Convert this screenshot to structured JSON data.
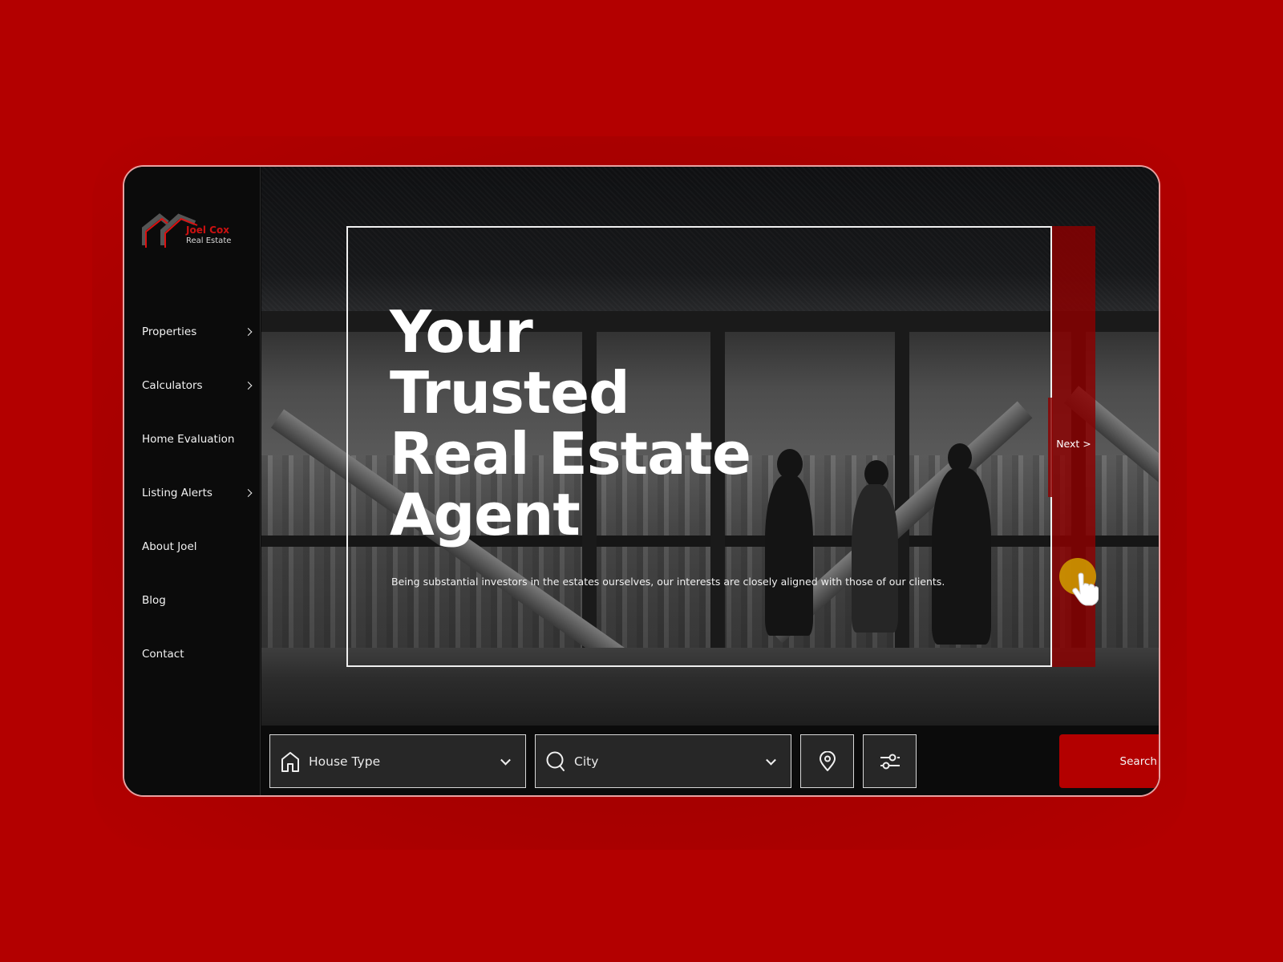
{
  "brand": {
    "name": "Joel Cox",
    "tagline": "Real Estate",
    "logo_icon": "house-roofs-icon",
    "accent_color": "#b30000",
    "accent_text_color": "#cc1111"
  },
  "sidebar": {
    "items": [
      {
        "label": "Properties",
        "has_submenu": true
      },
      {
        "label": "Calculators",
        "has_submenu": true
      },
      {
        "label": "Home Evaluation",
        "has_submenu": false
      },
      {
        "label": "Listing Alerts",
        "has_submenu": true
      },
      {
        "label": "About Joel",
        "has_submenu": false
      },
      {
        "label": "Blog",
        "has_submenu": false
      },
      {
        "label": "Contact",
        "has_submenu": false
      }
    ]
  },
  "hero": {
    "title_lines": [
      "Your",
      "Trusted",
      "Real Estate",
      "Agent"
    ],
    "subtitle": "Being substantial investors in the estates ourselves, our interests are closely aligned with those of our clients.",
    "next_label": "Next >",
    "background_image": "office-people-city-view-grayscale"
  },
  "search": {
    "house_type": {
      "placeholder": "House Type",
      "icon": "house-icon"
    },
    "city": {
      "placeholder": "City",
      "icon": "search-icon"
    },
    "location_button_icon": "map-pin-icon",
    "filter_button_icon": "sliders-icon",
    "submit_label": "Search Properties"
  },
  "colors": {
    "page_background": "#b30000",
    "panel_background": "#0b0b0b",
    "field_background": "#272727",
    "next_panel": "#8c0000",
    "cursor_highlight": "#d2a000"
  }
}
